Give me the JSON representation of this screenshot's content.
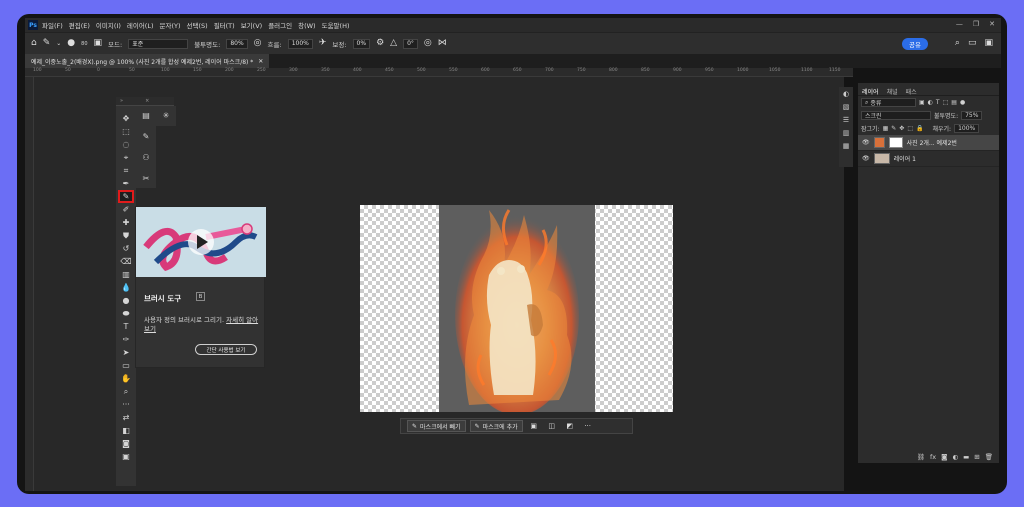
{
  "menubar": {
    "logo": "Ps",
    "items": [
      "파일(F)",
      "편집(E)",
      "이미지(I)",
      "레이어(L)",
      "문자(Y)",
      "선택(S)",
      "필터(T)",
      "보기(V)",
      "플러그인",
      "창(W)",
      "도움말(H)"
    ]
  },
  "options": {
    "brush_size": "80",
    "mode_label": "모드:",
    "mode_value": "표준",
    "opacity_label": "불투명도:",
    "opacity_value": "80%",
    "flow_label": "흐름:",
    "flow_value": "100%",
    "smoothing_label": "보정:",
    "smoothing_value": "0%",
    "angle_value": "0°",
    "share_label": "공유"
  },
  "tab": {
    "title": "예제_이중노출_2(배경X).png @ 100% (사진 2개를 합성 예제2번, 레이어 마스크/8) *"
  },
  "ruler": {
    "ticks": [
      "100",
      "50",
      "0",
      "50",
      "100",
      "150",
      "200",
      "250",
      "300",
      "350",
      "400",
      "450",
      "500",
      "550",
      "600",
      "650",
      "700",
      "750",
      "800",
      "850",
      "900",
      "950",
      "1000",
      "1050",
      "1100",
      "1150"
    ]
  },
  "tooltip": {
    "title": "브러시 도구",
    "shortcut": "B",
    "description": "사용자 정의 브러시로 그리기.",
    "link": "자세히 알아보기",
    "button": "간단 사용법 보기"
  },
  "context_bar": {
    "subtract": "마스크에서 빼기",
    "add": "마스크에 추가",
    "more": "···"
  },
  "layers": {
    "tabs": [
      "레이어",
      "채널",
      "패스"
    ],
    "kind_label": "종류",
    "blend_mode": "스크린",
    "opacity_label": "불투명도:",
    "opacity_value": "75%",
    "lock_label": "잠그기:",
    "fill_label": "채우기:",
    "fill_value": "100%",
    "items": [
      {
        "name": "사진 2개... 예제2번",
        "selected": true
      },
      {
        "name": "레이어 1",
        "selected": false
      }
    ]
  },
  "colors": {
    "accent": "#2b6de8",
    "highlight": "#e01b1b",
    "background": "#6b6ef5"
  }
}
